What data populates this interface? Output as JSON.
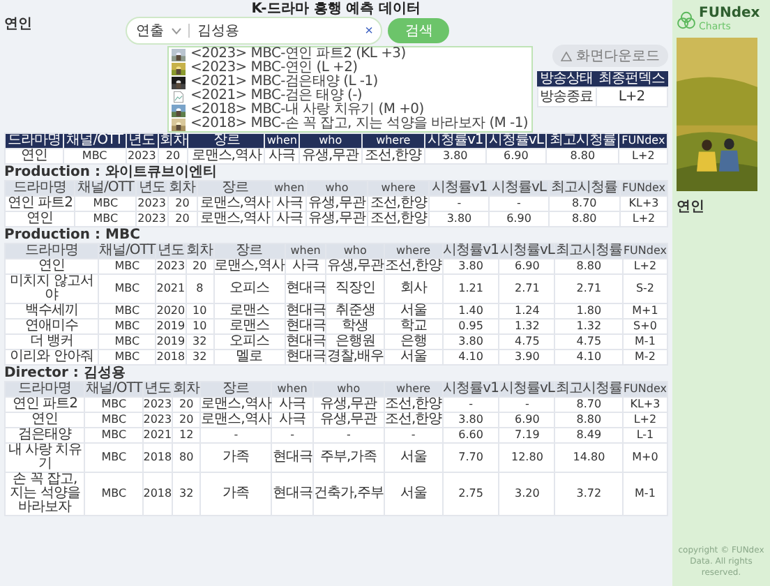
{
  "title": "K-드라마 흥행 예측 데이터",
  "search": {
    "category": "연출",
    "value": "김성용",
    "clear": "×",
    "button": "검색"
  },
  "suggestions": [
    {
      "text": "<2023> MBC-연인 파트2 (KL +3)",
      "kind": "picture"
    },
    {
      "text": "<2023> MBC-연인 (L +2)",
      "kind": "picture"
    },
    {
      "text": "<2021> MBC-검은태양 (L -1)",
      "kind": "picture"
    },
    {
      "text": "<2021> MBC-검은 태양 (-)",
      "kind": "broken"
    },
    {
      "text": "<2018> MBC-내 사랑 치유기 (M +0)",
      "kind": "picture"
    },
    {
      "text": "<2018> MBC-손 꼭 잡고, 지는 석양을 바라보자 (M -1)",
      "kind": "picture"
    }
  ],
  "download_button": "화면다운로드",
  "status": {
    "columns": [
      "방송상태",
      "최종펀덱스"
    ],
    "values": [
      "방송종료",
      "L+2"
    ]
  },
  "sections": [
    {
      "title": "연인",
      "highlighted": true,
      "columns": [
        "드라마명",
        "채널/OTT",
        "년도",
        "회차",
        "장르",
        "when",
        "who",
        "where",
        "시청률v1",
        "시청률vL",
        "최고시청률",
        "FUNdex"
      ],
      "rows": [
        [
          "연인",
          "MBC",
          "2023",
          "20",
          "로맨스,역사",
          "사극",
          "유생,무관",
          "조선,한양",
          "3.80",
          "6.90",
          "8.80",
          "L+2"
        ]
      ]
    },
    {
      "title": "Production : 와이트큐브이엔티",
      "highlighted": false,
      "columns": [
        "드라마명",
        "채널/OTT",
        "년도",
        "회차",
        "장르",
        "when",
        "who",
        "where",
        "시청률v1",
        "시청률vL",
        "최고시청률",
        "FUNdex"
      ],
      "rows": [
        [
          "연인 파트2",
          "MBC",
          "2023",
          "20",
          "로맨스,역사",
          "사극",
          "유생,무관",
          "조선,한양",
          "-",
          "-",
          "8.70",
          "KL+3"
        ],
        [
          "연인",
          "MBC",
          "2023",
          "20",
          "로맨스,역사",
          "사극",
          "유생,무관",
          "조선,한양",
          "3.80",
          "6.90",
          "8.80",
          "L+2"
        ]
      ]
    },
    {
      "title": "Production : MBC",
      "highlighted": false,
      "columns": [
        "드라마명",
        "채널/OTT",
        "년도",
        "회차",
        "장르",
        "when",
        "who",
        "where",
        "시청률v1",
        "시청률vL",
        "최고시청률",
        "FUNdex"
      ],
      "rows": [
        [
          "연인",
          "MBC",
          "2023",
          "20",
          "로맨스,역사",
          "사극",
          "유생,무관",
          "조선,한양",
          "3.80",
          "6.90",
          "8.80",
          "L+2"
        ],
        [
          "미치지 않고서야",
          "MBC",
          "2021",
          "8",
          "오피스",
          "현대극",
          "직장인",
          "회사",
          "1.21",
          "2.71",
          "2.71",
          "S-2"
        ],
        [
          "백수세끼",
          "MBC",
          "2020",
          "10",
          "로맨스",
          "현대극",
          "취준생",
          "서울",
          "1.40",
          "1.24",
          "1.80",
          "M+1"
        ],
        [
          "연애미수",
          "MBC",
          "2019",
          "10",
          "로맨스",
          "현대극",
          "학생",
          "학교",
          "0.95",
          "1.32",
          "1.32",
          "S+0"
        ],
        [
          "더 뱅커",
          "MBC",
          "2019",
          "32",
          "오피스",
          "현대극",
          "은행원",
          "은행",
          "3.80",
          "4.75",
          "4.75",
          "M-1"
        ],
        [
          "이리와 안아줘",
          "MBC",
          "2018",
          "32",
          "멜로",
          "현대극",
          "경찰,배우",
          "서울",
          "4.10",
          "3.90",
          "4.10",
          "M-2"
        ]
      ]
    },
    {
      "title": "Director : 김성용",
      "highlighted": false,
      "columns": [
        "드라마명",
        "채널/OTT",
        "년도",
        "회차",
        "장르",
        "when",
        "who",
        "where",
        "시청률v1",
        "시청률vL",
        "최고시청률",
        "FUNdex"
      ],
      "rows": [
        [
          "연인 파트2",
          "MBC",
          "2023",
          "20",
          "로맨스,역사",
          "사극",
          "유생,무관",
          "조선,한양",
          "-",
          "-",
          "8.70",
          "KL+3"
        ],
        [
          "연인",
          "MBC",
          "2023",
          "20",
          "로맨스,역사",
          "사극",
          "유생,무관",
          "조선,한양",
          "3.80",
          "6.90",
          "8.80",
          "L+2"
        ],
        [
          "검은태양",
          "MBC",
          "2021",
          "12",
          "-",
          "-",
          "-",
          "-",
          "6.60",
          "7.19",
          "8.49",
          "L-1"
        ],
        [
          "내 사랑 치유기",
          "MBC",
          "2018",
          "80",
          "가족",
          "현대극",
          "주부,가족",
          "서울",
          "7.70",
          "12.80",
          "14.80",
          "M+0"
        ],
        [
          "손 꼭 잡고, 지는 석양을 바라보자",
          "MBC",
          "2018",
          "32",
          "가족",
          "현대극",
          "건축가,주부",
          "서울",
          "2.75",
          "3.20",
          "3.72",
          "M-1"
        ]
      ]
    }
  ],
  "side": {
    "logo": "FUNdex",
    "logo_sub": "Charts",
    "poster_title": "연인",
    "footer": "copyright © FUNdex Data. All rights reserved."
  }
}
